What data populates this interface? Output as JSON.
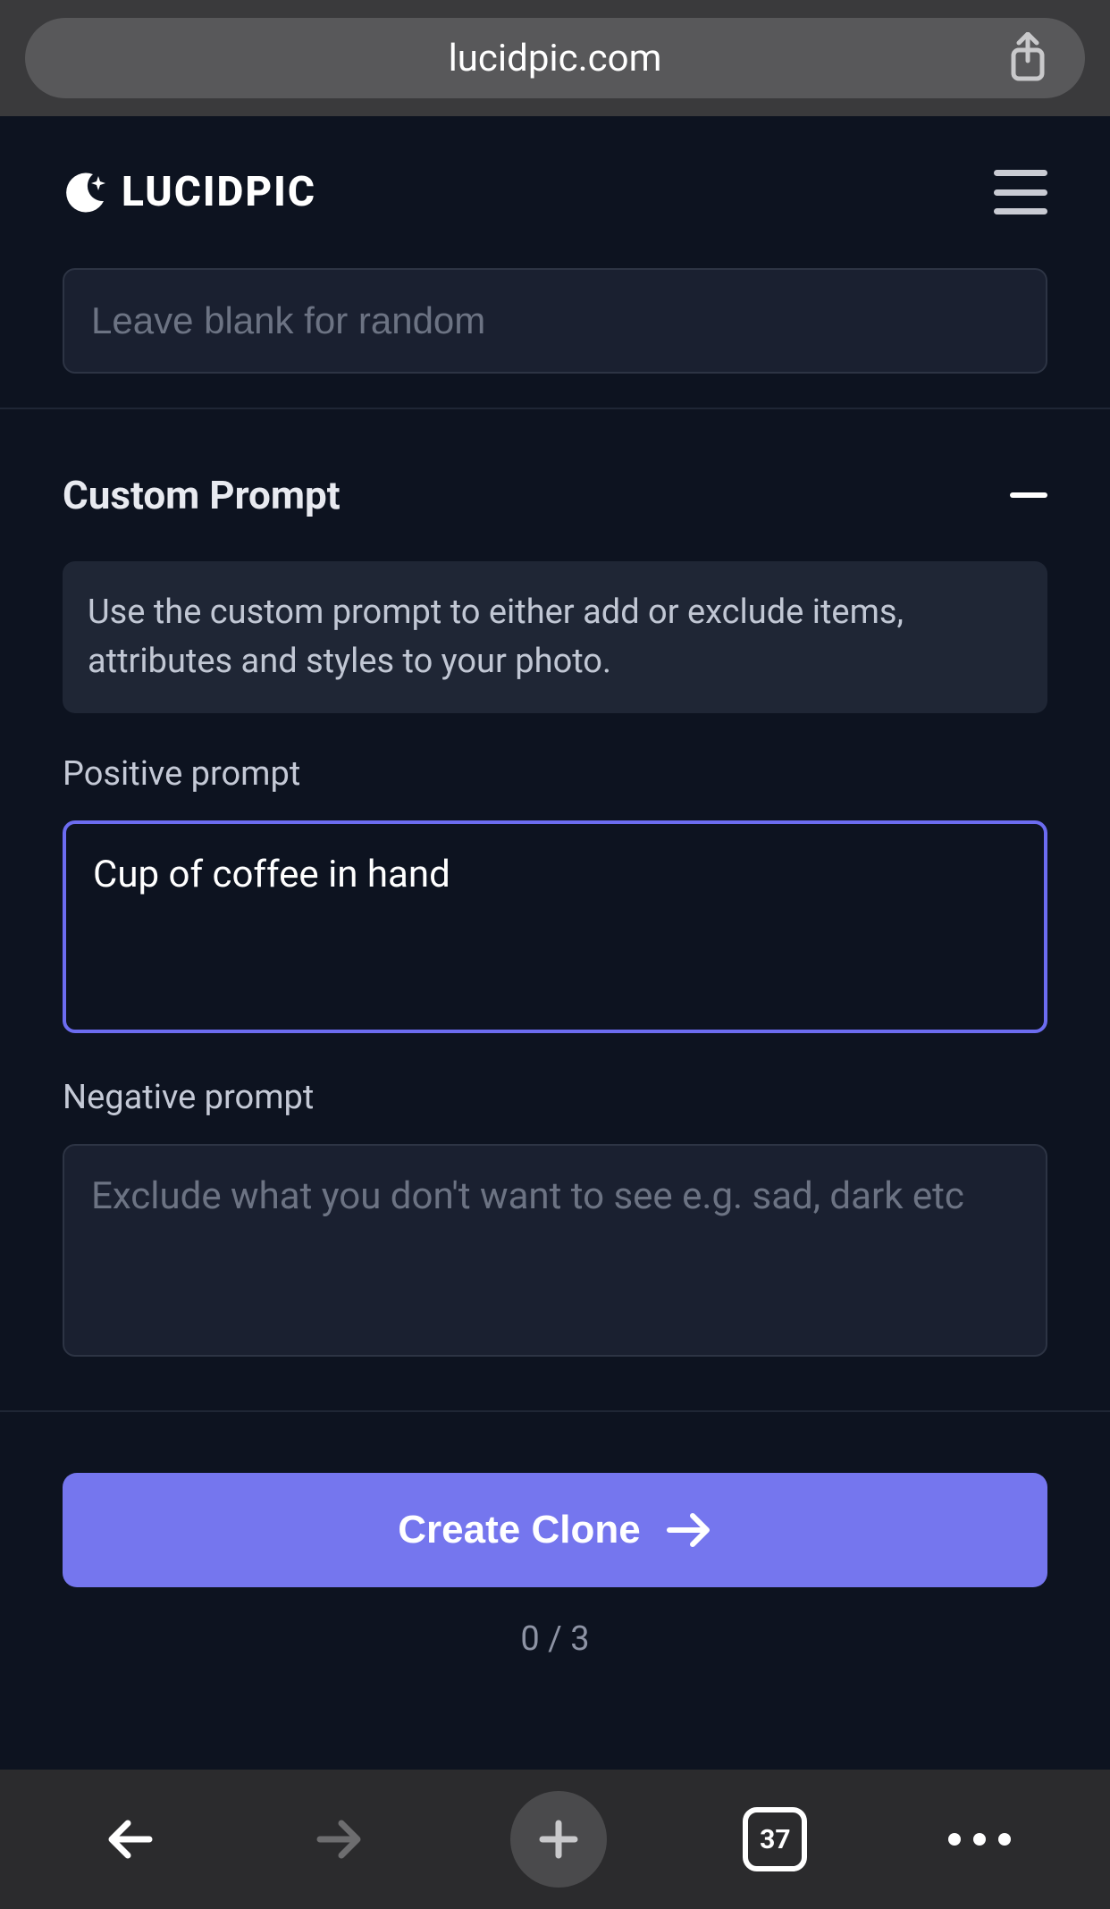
{
  "browser": {
    "url": "lucidpic.com",
    "tab_count": "37"
  },
  "app": {
    "brand": "LUCIDPIC"
  },
  "random_input": {
    "placeholder": "Leave blank for random",
    "value": ""
  },
  "custom_prompt": {
    "title": "Custom Prompt",
    "help": "Use the custom prompt to either add or exclude items, attributes and styles to your photo.",
    "positive_label": "Positive prompt",
    "positive_value": "Cup of coffee in hand",
    "negative_label": "Negative prompt",
    "negative_placeholder": "Exclude what you don't want to see e.g. sad, dark etc",
    "negative_value": ""
  },
  "action": {
    "create_label": "Create Clone",
    "counter": "0 / 3"
  }
}
